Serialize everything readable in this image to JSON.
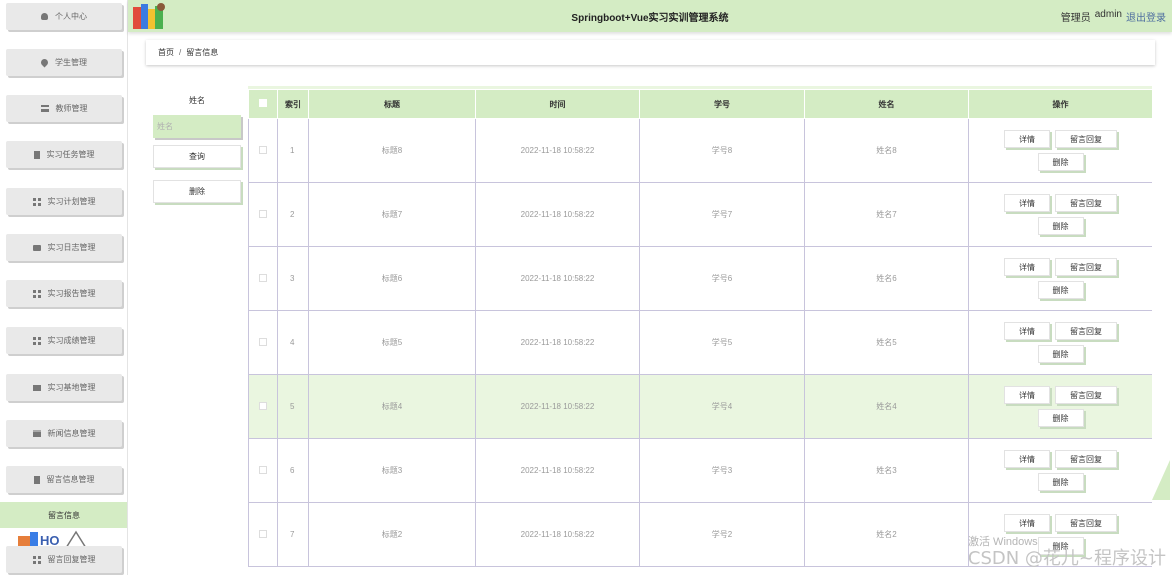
{
  "header": {
    "title": "Springboot+Vue实习实训管理系统",
    "user_role": "管理员",
    "user_name": "admin",
    "logout": "退出登录"
  },
  "sidebar": {
    "items": [
      {
        "label": "个人中心",
        "icon": "user-icon"
      },
      {
        "label": "学生管理",
        "icon": "pin-icon"
      },
      {
        "label": "教师管理",
        "icon": "list-icon"
      },
      {
        "label": "实习任务管理",
        "icon": "document-icon"
      },
      {
        "label": "实习计划管理",
        "icon": "grid-icon"
      },
      {
        "label": "实习日志管理",
        "icon": "box-icon"
      },
      {
        "label": "实习报告管理",
        "icon": "grid-icon"
      },
      {
        "label": "实习成绩管理",
        "icon": "grid-icon"
      },
      {
        "label": "实习基地管理",
        "icon": "monitor-icon"
      },
      {
        "label": "新闻信息管理",
        "icon": "news-icon"
      },
      {
        "label": "留言信息管理",
        "icon": "document-icon"
      },
      {
        "label": "留言回复管理",
        "icon": "grid-icon"
      }
    ],
    "active_sub": "留言信息"
  },
  "breadcrumb": {
    "home": "首页",
    "sep": "/",
    "current": "留言信息"
  },
  "search": {
    "label": "姓名",
    "placeholder": "姓名",
    "query_btn": "查询",
    "delete_btn": "删除"
  },
  "table": {
    "headers": [
      "索引",
      "标题",
      "时间",
      "学号",
      "姓名",
      "操作"
    ],
    "actions": {
      "detail": "详情",
      "reply": "留言回复",
      "delete": "删除"
    },
    "rows": [
      {
        "index": "1",
        "title": "标题8",
        "time": "2022-11-18 10:58:22",
        "student_no": "学号8",
        "name": "姓名8"
      },
      {
        "index": "2",
        "title": "标题7",
        "time": "2022-11-18 10:58:22",
        "student_no": "学号7",
        "name": "姓名7"
      },
      {
        "index": "3",
        "title": "标题6",
        "time": "2022-11-18 10:58:22",
        "student_no": "学号6",
        "name": "姓名6"
      },
      {
        "index": "4",
        "title": "标题5",
        "time": "2022-11-18 10:58:22",
        "student_no": "学号5",
        "name": "姓名5"
      },
      {
        "index": "5",
        "title": "标题4",
        "time": "2022-11-18 10:58:22",
        "student_no": "学号4",
        "name": "姓名4"
      },
      {
        "index": "6",
        "title": "标题3",
        "time": "2022-11-18 10:58:22",
        "student_no": "学号3",
        "name": "姓名3"
      },
      {
        "index": "7",
        "title": "标题2",
        "time": "2022-11-18 10:58:22",
        "student_no": "学号2",
        "name": "姓名2"
      }
    ],
    "highlighted_row": 4
  },
  "watermarks": {
    "windows": "激活 Windows",
    "csdn": "CSDN @花儿~程序设计"
  },
  "colors": {
    "accent": "#d4ecc4",
    "highlight": "#eaf6e0",
    "grid_line": "#c8c4dc"
  }
}
